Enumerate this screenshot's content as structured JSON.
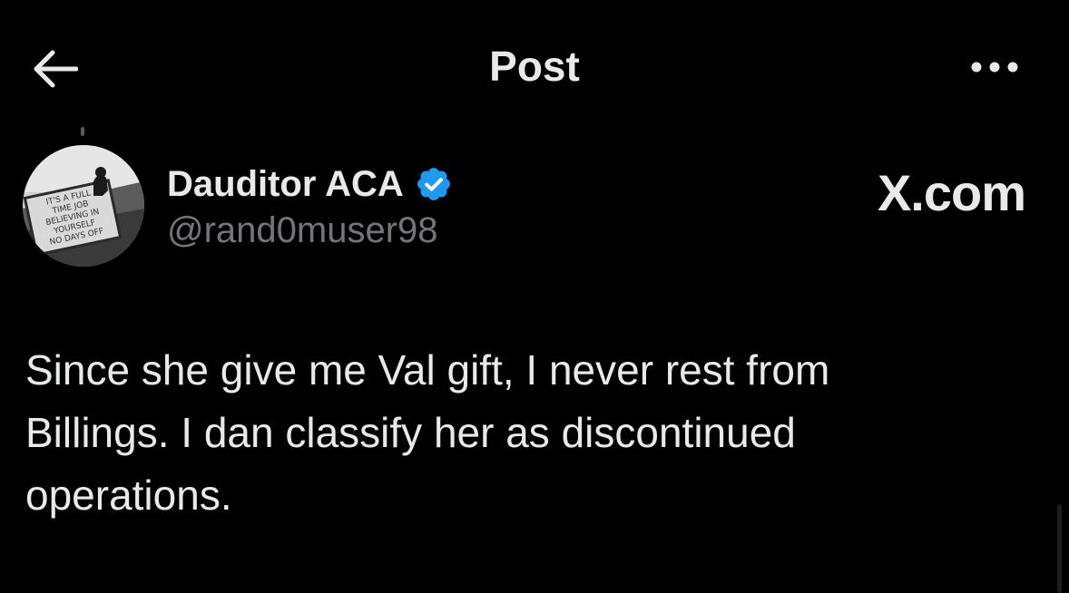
{
  "header": {
    "title": "Post",
    "back_icon": "arrow-left-icon",
    "more_icon": "more-horizontal-icon"
  },
  "author": {
    "display_name": "Dauditor ACA",
    "handle": "@rand0muser98",
    "verified": true,
    "verified_color": "#1d9bf0",
    "avatar_sign_text": [
      "IT'S A FULL",
      "TIME JOB",
      "BELIEVING IN",
      "YOURSELF",
      "NO DAYS OFF"
    ]
  },
  "watermark": {
    "logo_text": "X.com"
  },
  "post": {
    "text": "Since she give me Val gift, I never rest from\nBillings. I dan classify her as discontinued\noperations."
  },
  "colors": {
    "background": "#000000",
    "primary_text": "#e7e9ea",
    "secondary_text": "#71767b",
    "accent": "#1d9bf0"
  }
}
